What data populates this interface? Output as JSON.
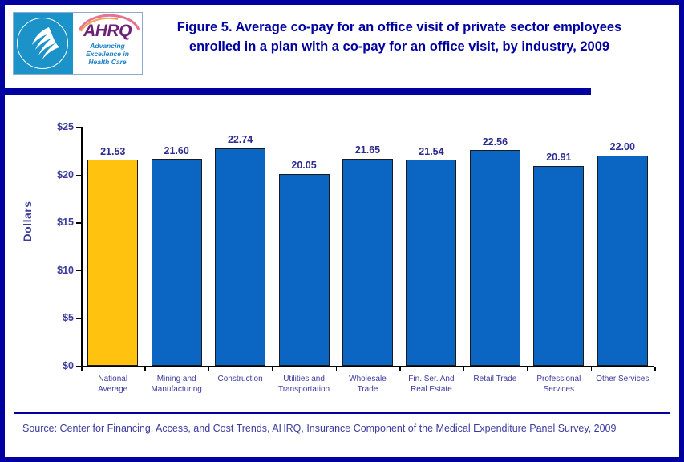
{
  "header": {
    "title": "Figure 5. Average co-pay for an office visit of private sector employees enrolled in a plan with a co-pay for an office visit, by industry, 2009",
    "logo": {
      "agency_seal": "hhs-seal",
      "wordmark": "AHRQ",
      "tagline_line1": "Advancing",
      "tagline_line2": "Excellence in",
      "tagline_line3": "Health Care"
    }
  },
  "footer": {
    "source": "Source: Center for Financing, Access, and Cost Trends, AHRQ, Insurance Component of the Medical Expenditure Panel Survey, 2009"
  },
  "colors": {
    "border": "#0000a0",
    "title_text": "#0000a0",
    "rule": "#0000a0",
    "highlight_bar": "#FFC20E",
    "bar": "#0B66C3",
    "bar_outline": "#1a1a1a",
    "label_text": "#3b3b9e",
    "value_text": "#2c2c8f"
  },
  "chart_data": {
    "type": "bar",
    "title": "Figure 5. Average co-pay for an office visit of private sector employees enrolled in a plan with a co-pay for an office visit, by industry, 2009",
    "xlabel": "",
    "ylabel": "Dollars",
    "ylim": [
      0,
      25
    ],
    "ytick_values": [
      0,
      5,
      10,
      15,
      20,
      25
    ],
    "ytick_labels": [
      "$0",
      "$5",
      "$10",
      "$15",
      "$20",
      "$25"
    ],
    "grid": false,
    "legend": "none",
    "categories": [
      "National Average",
      "Mining and Manufacturing",
      "Construction",
      "Utilities and Transportation",
      "Wholesale Trade",
      "Fin. Ser. And Real Estate",
      "Retail Trade",
      "Professional Services",
      "Other Services"
    ],
    "category_lines": [
      [
        "National",
        "Average"
      ],
      [
        "Mining and",
        "Manufacturing"
      ],
      [
        "Construction"
      ],
      [
        "Utilities and",
        "Transportation"
      ],
      [
        "Wholesale",
        "Trade"
      ],
      [
        "Fin. Ser. And",
        "Real Estate"
      ],
      [
        "Retail Trade"
      ],
      [
        "Professional",
        "Services"
      ],
      [
        "Other Services"
      ]
    ],
    "values": [
      21.53,
      21.6,
      22.74,
      20.05,
      21.65,
      21.54,
      22.56,
      20.91,
      22.0
    ],
    "value_labels": [
      "21.53",
      "21.60",
      "22.74",
      "20.05",
      "21.65",
      "21.54",
      "22.56",
      "20.91",
      "22.00"
    ],
    "bar_colors": [
      "#FFC20E",
      "#0B66C3",
      "#0B66C3",
      "#0B66C3",
      "#0B66C3",
      "#0B66C3",
      "#0B66C3",
      "#0B66C3",
      "#0B66C3"
    ]
  }
}
